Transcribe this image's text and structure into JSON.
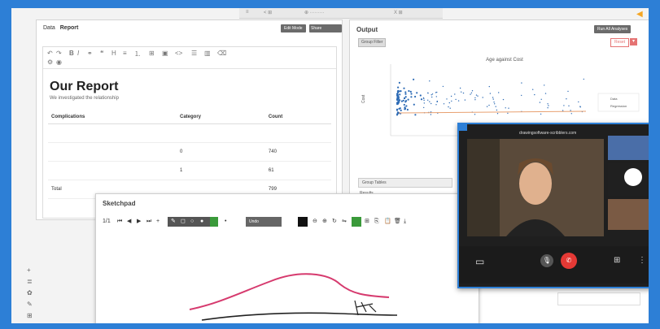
{
  "topbar": {
    "items": [
      "≡",
      "< ⊞",
      "⊕ ·········",
      "X  ⊞"
    ]
  },
  "report": {
    "crumb_a": "Data",
    "crumb_b": "Report",
    "btn_a": "Edit Mode",
    "btn_b": "Share Notebook",
    "title": "Our Report",
    "subtitle": "We investigated the relationship",
    "table": {
      "headers": [
        "Complications",
        "Category",
        "Count"
      ],
      "rows": [
        [
          "",
          "",
          ""
        ],
        [
          "",
          "0",
          "740"
        ],
        [
          "",
          "1",
          "61"
        ],
        [
          "Total",
          "",
          "799"
        ]
      ]
    }
  },
  "output": {
    "title": "Output",
    "btn": "Run All Analyses",
    "chip": "Group Filter",
    "reset": "Reset",
    "plot_title": "Age against Cost",
    "ylabel": "Cost",
    "legend": [
      "Data",
      "Regression"
    ],
    "group_tabs": "Group Tables",
    "group_label": "Results"
  },
  "sketchpad": {
    "title": "Sketchpad",
    "page": "1/1",
    "tool_label": "Undo"
  },
  "video": {
    "url": "drawingsoftware-scribblers.com"
  },
  "colors": {
    "accent": "#2d7fd6",
    "end_call": "#e53935",
    "green": "#3a9a3a"
  }
}
